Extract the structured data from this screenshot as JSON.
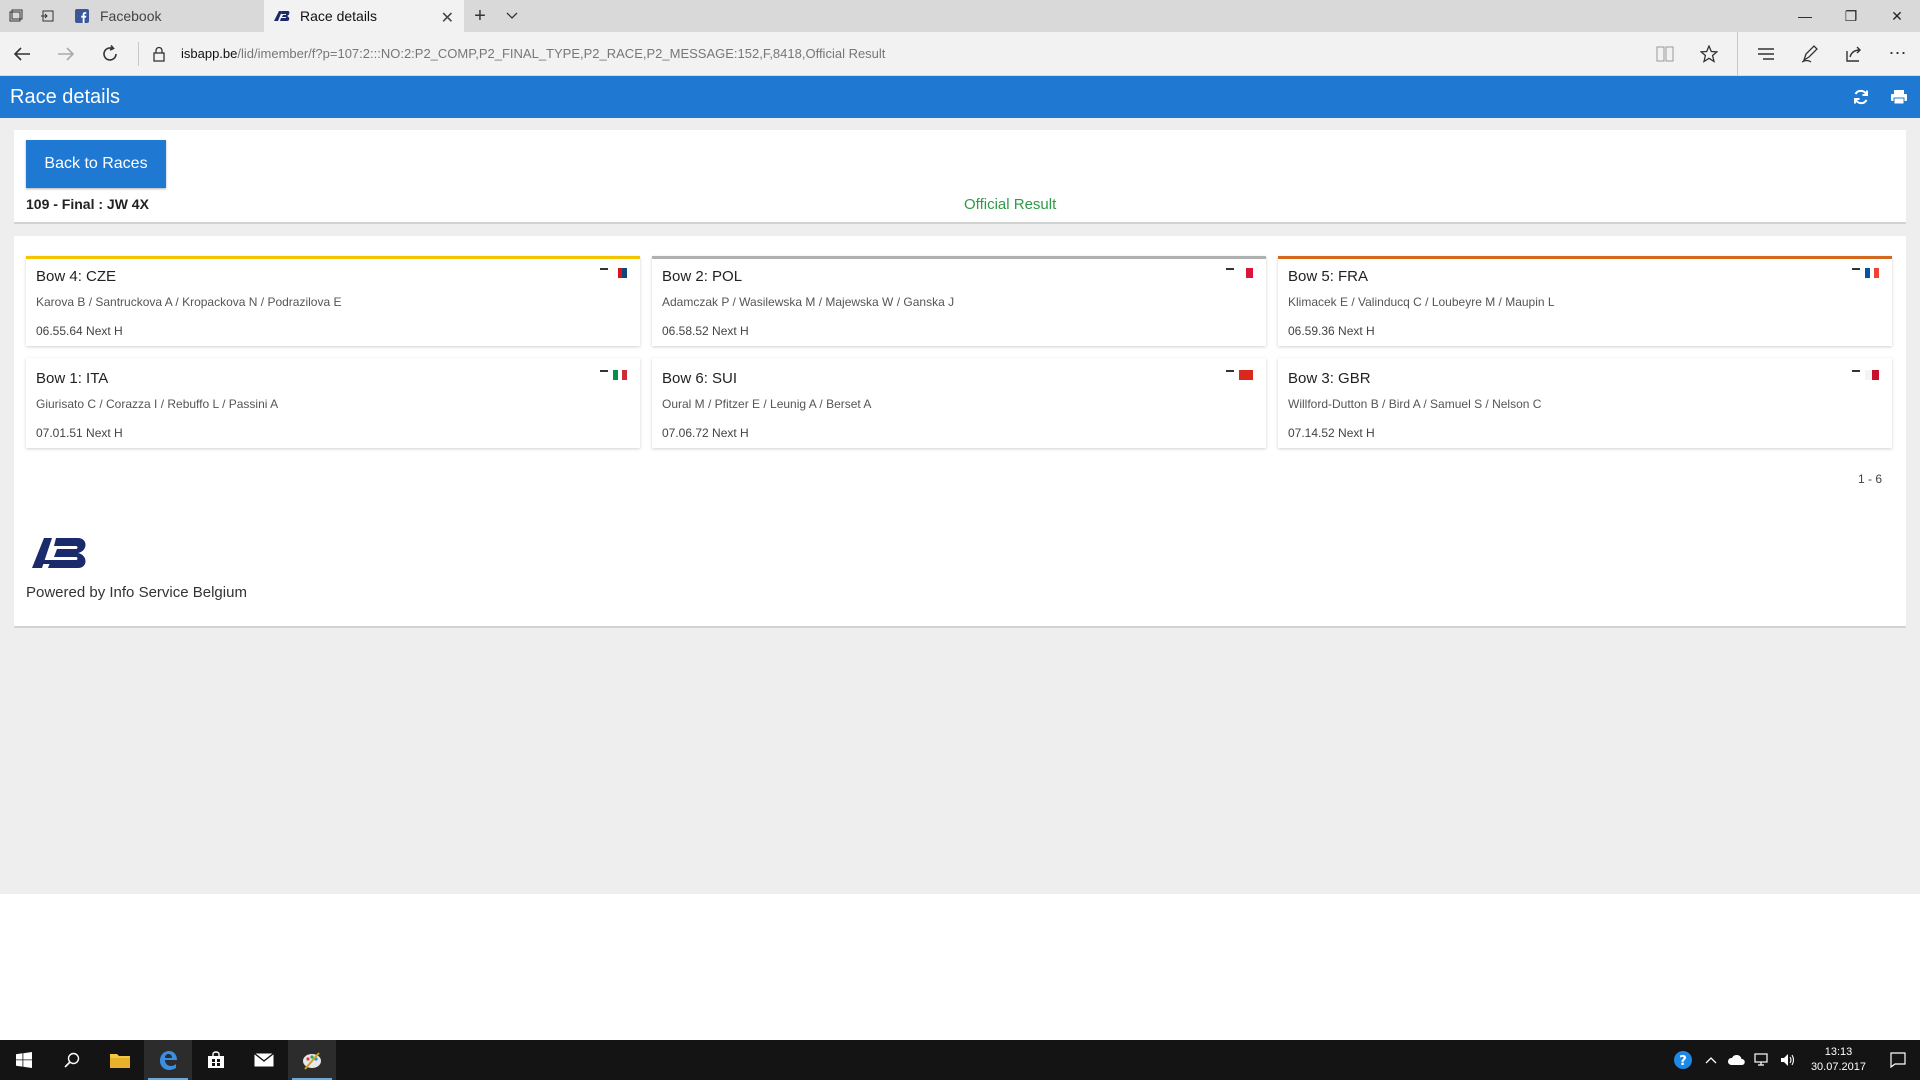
{
  "browser": {
    "tabs": [
      {
        "label": "Facebook",
        "icon": "facebook-icon",
        "active": false
      },
      {
        "label": "Race details",
        "icon": "isb-icon",
        "active": true
      }
    ],
    "address": {
      "host": "isbapp.be",
      "path": "/lid/imember/f?p=107:2:::NO:2:P2_COMP,P2_FINAL_TYPE,P2_RACE,P2_MESSAGE:152,F,8418,Official Result"
    }
  },
  "app": {
    "title": "Race details",
    "accent": "#1f78d1"
  },
  "race": {
    "back_label": "Back to Races",
    "label": "109 - Final : JW 4X",
    "status": "Official Result",
    "status_color": "#2e9b46"
  },
  "boats": [
    {
      "bow": "Bow 4: CZE",
      "crew": "Karova B / Santruckova A / Kropackova N / Podrazilova E",
      "time": "06.55.64 Next H",
      "rule_color": "#f2c500",
      "flag": [
        "#ffffff",
        "#d7141a",
        "#11457e"
      ]
    },
    {
      "bow": "Bow 2: POL",
      "crew": "Adamczak P / Wasilewska M / Majewska W / Ganska J",
      "time": "06.58.52 Next H",
      "rule_color": "#b0b0b0",
      "flag": [
        "#ffffff",
        "#dc143c"
      ]
    },
    {
      "bow": "Bow 5: FRA",
      "crew": "Klimacek E / Valinducq C / Loubeyre M / Maupin L",
      "time": "06.59.36 Next H",
      "rule_color": "#d2691e",
      "flag": [
        "#0055a4",
        "#ffffff",
        "#ef4135"
      ]
    },
    {
      "bow": "Bow 1: ITA",
      "crew": "Giurisato C / Corazza I / Rebuffo L / Passini A",
      "time": "07.01.51 Next H",
      "rule_color": "#ffffff",
      "flag": [
        "#009246",
        "#ffffff",
        "#ce2b37"
      ]
    },
    {
      "bow": "Bow 6: SUI",
      "crew": "Oural M / Pfitzer E / Leunig A / Berset A",
      "time": "07.06.72 Next H",
      "rule_color": "#ffffff",
      "flag": [
        "#da291c",
        "#da291c"
      ]
    },
    {
      "bow": "Bow 3: GBR",
      "crew": "Willford-Dutton B / Bird A / Samuel S / Nelson C",
      "time": "07.14.52 Next H",
      "rule_color": "#ffffff",
      "flag": [
        "#f4f4f4",
        "#c8102e"
      ]
    }
  ],
  "pagination": "1 - 6",
  "footer": {
    "powered_by": "Powered by Info Service Belgium",
    "logo_text": "ISB"
  },
  "taskbar": {
    "time": "13:13",
    "date": "30.07.2017"
  }
}
